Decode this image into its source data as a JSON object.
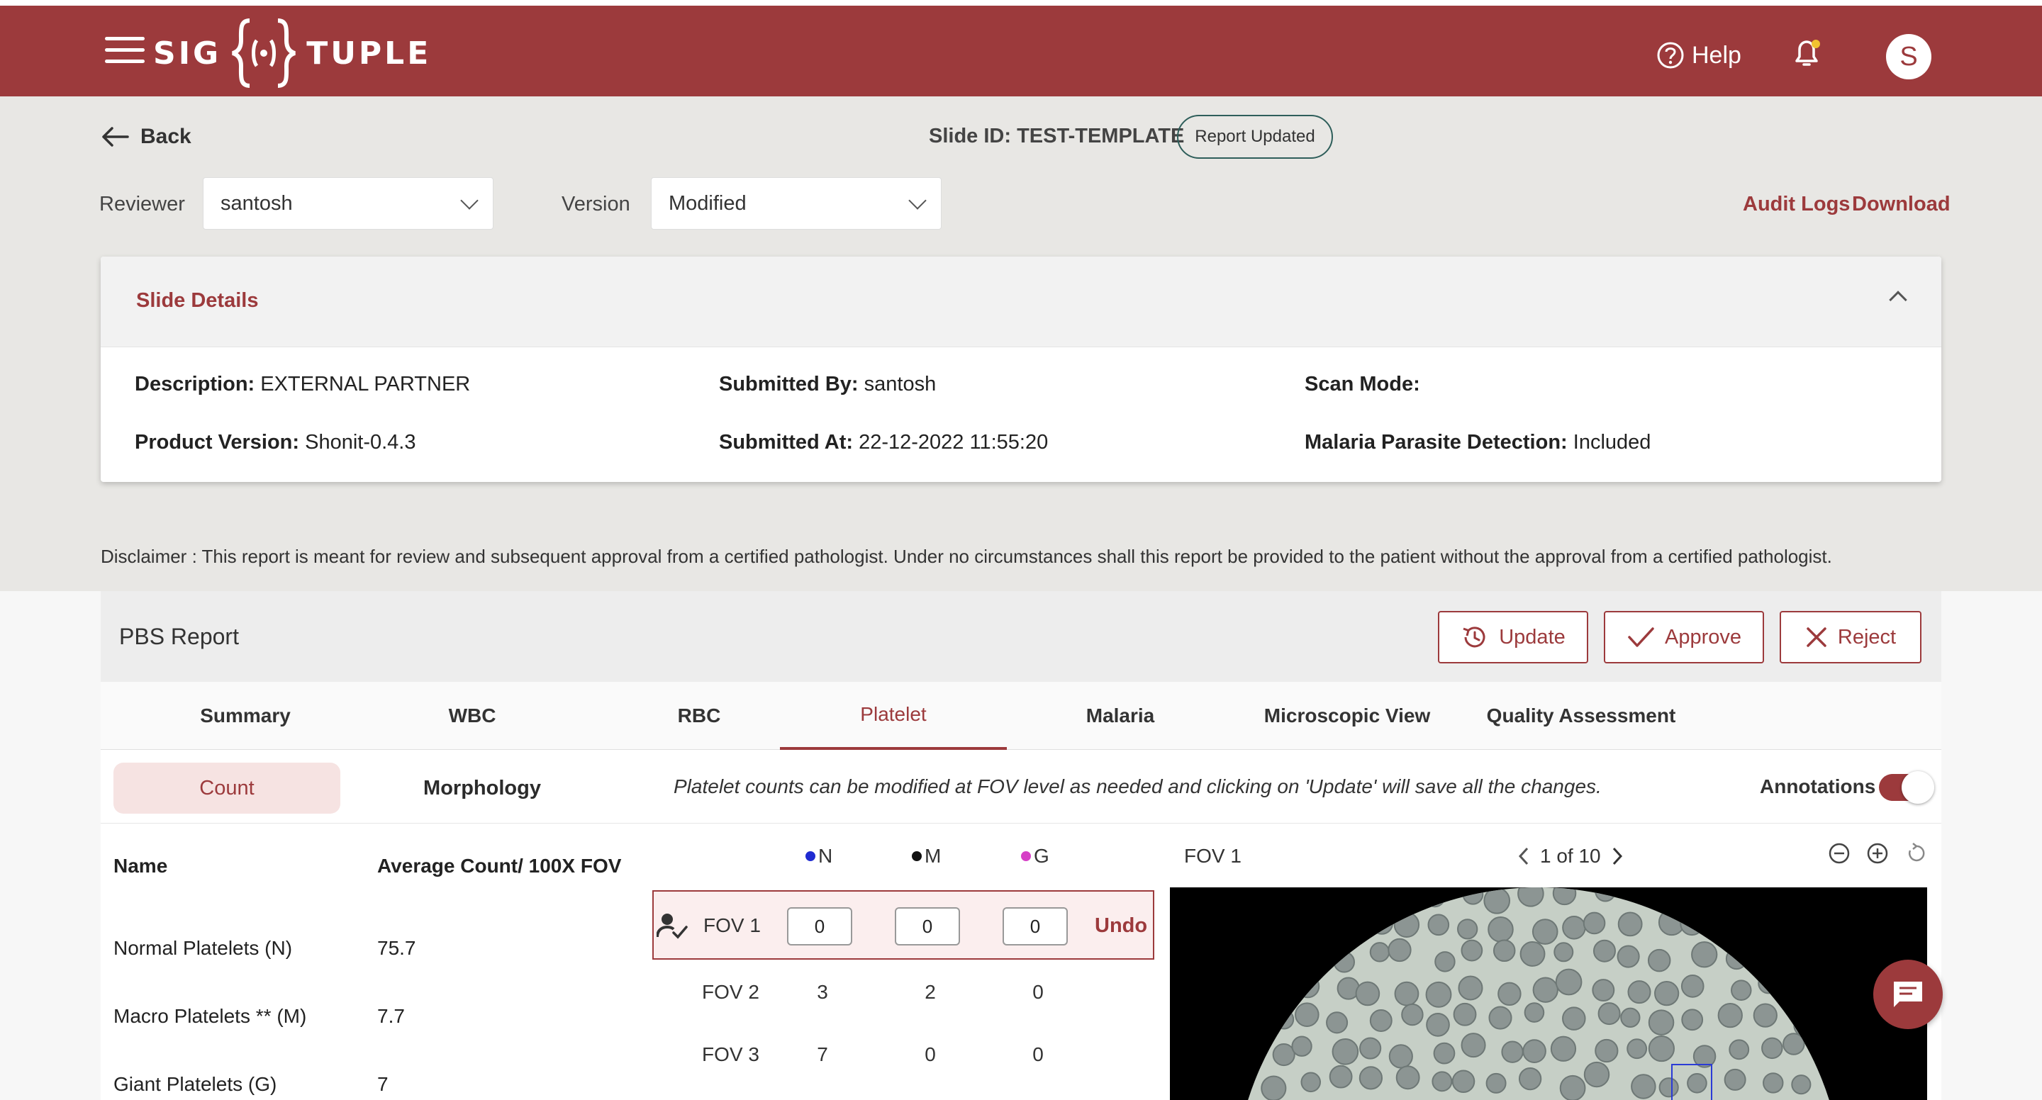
{
  "header": {
    "logo_left": "SIG",
    "logo_right": "TUPLE",
    "help_label": "Help",
    "avatar_initial": "S",
    "brand_color": "#9c3a3c"
  },
  "toolbar": {
    "back_label": "Back",
    "slide_id": "Slide ID: TEST-TEMPLATE",
    "report_status": "Report Updated",
    "reviewer_label": "Reviewer",
    "reviewer_value": "santosh",
    "version_label": "Version",
    "version_value": "Modified",
    "audit_logs": "Audit Logs",
    "download": "Download"
  },
  "slide_details": {
    "title": "Slide Details",
    "description_label": "Description:",
    "description_value": "EXTERNAL PARTNER",
    "submitted_by_label": "Submitted By:",
    "submitted_by_value": "santosh",
    "scan_mode_label": "Scan Mode:",
    "scan_mode_value": "",
    "product_version_label": "Product Version:",
    "product_version_value": "Shonit-0.4.3",
    "submitted_at_label": "Submitted At:",
    "submitted_at_value": "22-12-2022 11:55:20",
    "malaria_label": "Malaria Parasite Detection:",
    "malaria_value": "Included"
  },
  "disclaimer": "Disclaimer :  This report is meant for review and subsequent approval from a certified pathologist. Under no circumstances shall this report be provided to the patient without the approval from a certified pathologist.",
  "report": {
    "title": "PBS Report",
    "update_label": "Update",
    "approve_label": "Approve",
    "reject_label": "Reject",
    "tabs": [
      "Summary",
      "WBC",
      "RBC",
      "Platelet",
      "Malaria",
      "Microscopic View",
      "Quality Assessment"
    ],
    "active_tab": "Platelet",
    "subtabs": [
      "Count",
      "Morphology"
    ],
    "active_subtab": "Count",
    "info_text": "Platelet counts can be modified at FOV level as needed and clicking on 'Update' will save all the changes.",
    "annotations_label": "Annotations",
    "annotations_on": true
  },
  "platelet_table": {
    "col_name": "Name",
    "col_avg": "Average Count/ 100X FOV",
    "rows": [
      {
        "name": "Normal Platelets (N)",
        "value": "75.7"
      },
      {
        "name": "Macro Platelets ** (M)",
        "value": "7.7"
      },
      {
        "name": "Giant Platelets (G)",
        "value": "7"
      }
    ]
  },
  "fov_table": {
    "headers": [
      {
        "label": "N",
        "color": "#1f2bd1"
      },
      {
        "label": "M",
        "color": "#111111"
      },
      {
        "label": "G",
        "color": "#d63fc6"
      }
    ],
    "rows": [
      {
        "fov": "FOV 1",
        "n": "0",
        "m": "0",
        "g": "0",
        "editing": true
      },
      {
        "fov": "FOV 2",
        "n": "3",
        "m": "2",
        "g": "0"
      },
      {
        "fov": "FOV 3",
        "n": "7",
        "m": "0",
        "g": "0"
      }
    ],
    "undo_label": "Undo"
  },
  "viewer": {
    "title": "FOV 1",
    "pager": "1 of 10"
  }
}
